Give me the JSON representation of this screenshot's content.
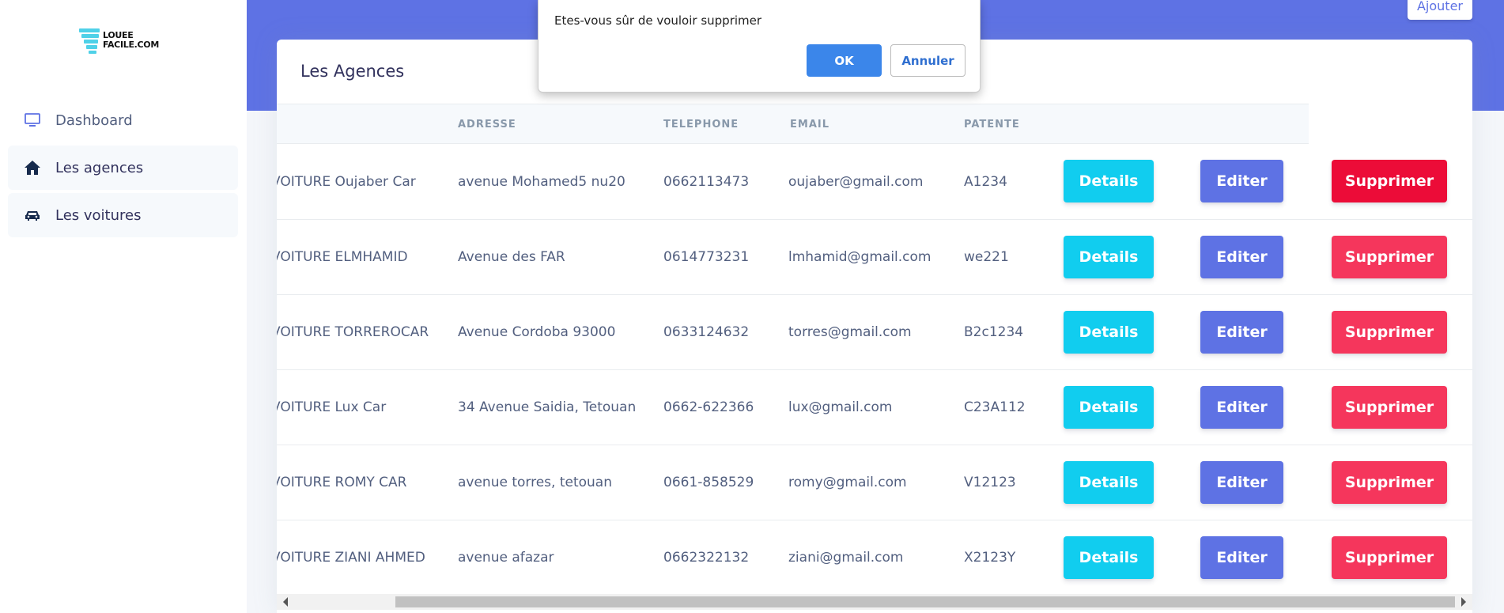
{
  "sidebar": {
    "logo": {
      "line1": "LOUEE",
      "line2": "FACILE.COM"
    },
    "items": [
      {
        "label": "Dashboard",
        "icon": "monitor-icon"
      },
      {
        "label": "Les agences",
        "icon": "home-icon"
      },
      {
        "label": "Les voitures",
        "icon": "car-icon"
      }
    ]
  },
  "header": {
    "add_label": "Ajouter"
  },
  "card": {
    "title": "Les Agences",
    "columns": [
      "",
      "ADRESSE",
      "TELEPHONE",
      "EMAIL",
      "PATENTE"
    ],
    "rows": [
      {
        "name": "VOITURE Oujaber Car",
        "adresse": "avenue Mohamed5 nu20",
        "telephone": "0662113473",
        "email": "oujaber@gmail.com",
        "patente": "A1234"
      },
      {
        "name": "VOITURE ELMHAMID",
        "adresse": "Avenue des FAR",
        "telephone": "0614773231",
        "email": "lmhamid@gmail.com",
        "patente": "we221"
      },
      {
        "name": "VOITURE TORREROCAR",
        "adresse": "Avenue Cordoba 93000",
        "telephone": "0633124632",
        "email": "torres@gmail.com",
        "patente": "B2c1234"
      },
      {
        "name": "VOITURE Lux Car",
        "adresse": "34 Avenue Saidia, Tetouan",
        "telephone": "0662-622366",
        "email": "lux@gmail.com",
        "patente": "C23A112"
      },
      {
        "name": "VOITURE ROMY CAR",
        "adresse": "avenue torres, tetouan",
        "telephone": "0661-858529",
        "email": "romy@gmail.com",
        "patente": "V12123"
      },
      {
        "name": "VOITURE ZIANI AHMED",
        "adresse": "avenue afazar",
        "telephone": "0662322132",
        "email": "ziani@gmail.com",
        "patente": "X2123Y"
      }
    ],
    "actions": {
      "details": "Details",
      "edit": "Editer",
      "delete": "Supprimer"
    }
  },
  "dialog": {
    "message": "Etes-vous sûr de vouloir supprimer",
    "ok_label": "OK",
    "cancel_label": "Annuler"
  },
  "colors": {
    "primary": "#5e72e4",
    "info": "#11cdef",
    "danger": "#f5365c",
    "dialog_ok": "#3b86ea"
  }
}
